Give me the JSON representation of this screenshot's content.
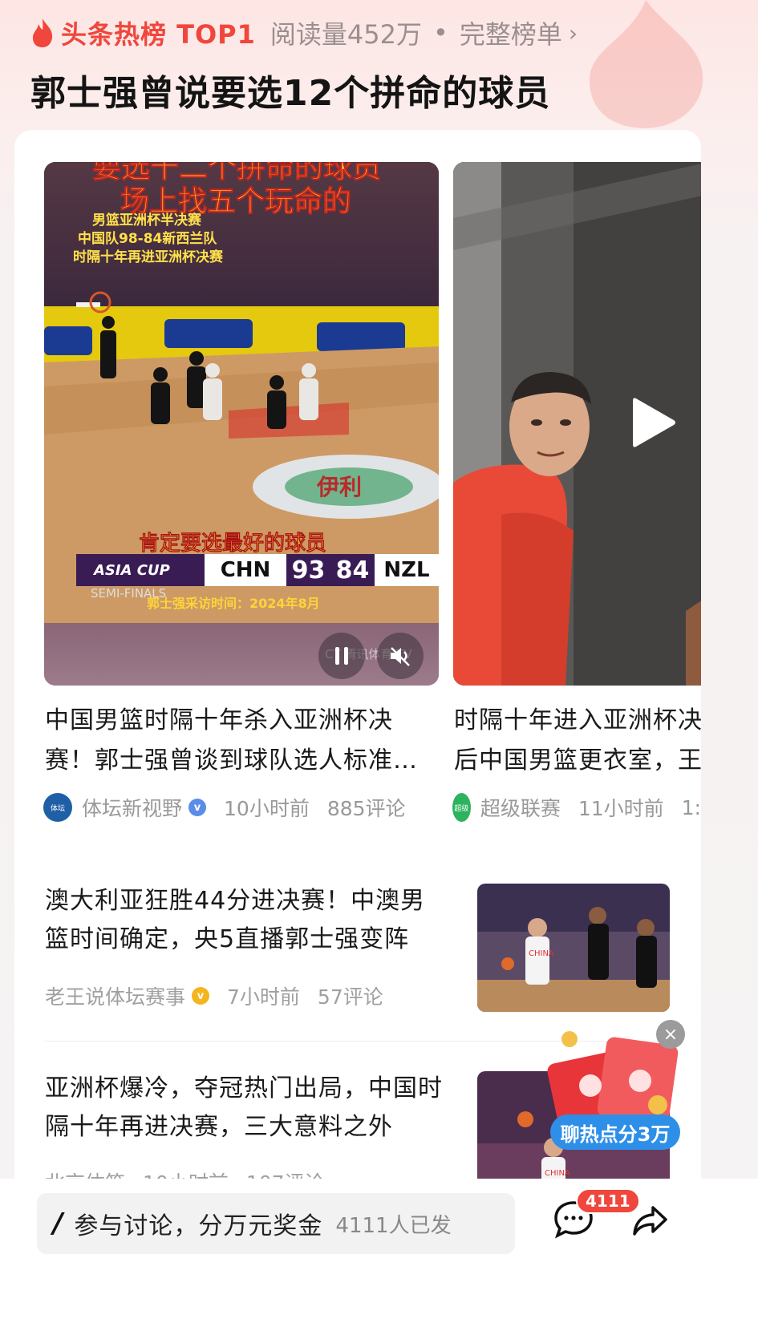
{
  "hot": {
    "title": "头条热榜 TOP1",
    "reads": "阅读量452万",
    "dot": "•",
    "full_list": "完整榜单",
    "chevron": "›"
  },
  "headline": "郭士强曾说要选12个拼命的球员",
  "video1": {
    "overlay_top1": "要选十二个拼命的球员",
    "overlay_top2": "场上找五个玩命的",
    "overlay_info": [
      "男篮亚洲杯半决赛",
      "中国队98-84新西兰队",
      "时隔十年再进亚洲杯决赛"
    ],
    "overlay_mid": "肯定要选最好的球员",
    "overlay_date": "郭士强采访时间：2024年8月",
    "score": {
      "league": "ASIA CUP",
      "sub": "SEMI-FINALS",
      "home": "CHN",
      "home_score": "93",
      "away_score": "84",
      "away": "NZL"
    },
    "watermark": "CT 腾讯体育 TV",
    "title": "中国男篮时隔十年杀入亚洲杯决赛！郭士强曾谈到球队选人标准…",
    "source": "体坛新视野",
    "time": "10小时前",
    "comments": "885评论"
  },
  "video2": {
    "title_line1": "时隔十年进入亚洲杯决",
    "title_line2": "后中国男篮更衣室，王",
    "source": "超级联赛",
    "time": "11小时前",
    "comments": "1:"
  },
  "articles": [
    {
      "title": "澳大利亚狂胜44分进决赛！中澳男篮时间确定，央5直播郭士强变阵",
      "source": "老王说体坛赛事",
      "time": "7小时前",
      "comments": "57评论"
    },
    {
      "title": "亚洲杯爆冷，夺冠热门出局，中国时隔十年再进决赛，三大意料之外",
      "source": "北京体笑",
      "time": "10小时前",
      "comments": "107评论"
    }
  ],
  "redpack": {
    "label": "聊热点分3万",
    "close": "×"
  },
  "bottom": {
    "pen": "/",
    "discuss": "参与讨论，分万元奖金",
    "discuss_count": "4111人已发",
    "comment_badge": "4111"
  },
  "colors": {
    "accent": "#f0463c",
    "link_blue": "#2e8fe8"
  },
  "icons": [
    "flame-icon",
    "verified-icon",
    "pause-icon",
    "mute-icon",
    "play-icon",
    "close-icon",
    "pen-icon",
    "comment-icon",
    "share-icon"
  ]
}
